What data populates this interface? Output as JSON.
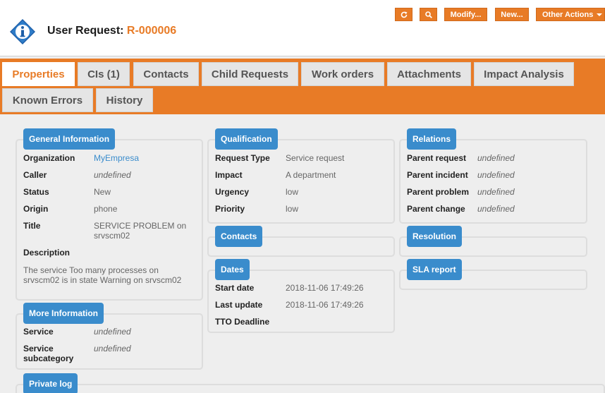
{
  "header": {
    "title_prefix": "User Request: ",
    "ref": "R-000006",
    "buttons": {
      "modify": "Modify...",
      "new": "New...",
      "other_actions": "Other Actions"
    }
  },
  "tabs": [
    "Properties",
    "CIs (1)",
    "Contacts",
    "Child Requests",
    "Work orders",
    "Attachments",
    "Impact Analysis",
    "Known Errors",
    "History"
  ],
  "general": {
    "legend": "General Information",
    "organization_label": "Organization",
    "organization_value": "MyEmpresa",
    "caller_label": "Caller",
    "caller_value": "undefined",
    "status_label": "Status",
    "status_value": "New",
    "origin_label": "Origin",
    "origin_value": "phone",
    "title_label": "Title",
    "title_value_1": "SERVICE PROBLEM on",
    "title_value_2": "srvscm02",
    "description_label": "Description",
    "description_1": "The service Too many processes on",
    "description_2": "srvscm02 is in state Warning on srvscm02"
  },
  "more": {
    "legend": "More Information",
    "service_label": "Service",
    "service_value": "undefined",
    "subcat_label_1": "Service",
    "subcat_label_2": "subcategory",
    "subcat_value": "undefined"
  },
  "private_log": {
    "legend": "Private log"
  },
  "qualification": {
    "legend": "Qualification",
    "request_type_label": "Request Type",
    "request_type_value": "Service request",
    "impact_label": "Impact",
    "impact_value": "A department",
    "urgency_label": "Urgency",
    "urgency_value": "low",
    "priority_label": "Priority",
    "priority_value": "low"
  },
  "contacts": {
    "legend": "Contacts"
  },
  "dates": {
    "legend": "Dates",
    "start_label": "Start date",
    "start_value": "2018-11-06 17:49:26",
    "update_label": "Last update",
    "update_value": "2018-11-06 17:49:26",
    "tto_label": "TTO Deadline"
  },
  "relations": {
    "legend": "Relations",
    "parent_request_label": "Parent request",
    "parent_request_value": "undefined",
    "parent_incident_label": "Parent incident",
    "parent_incident_value": "undefined",
    "parent_problem_label": "Parent problem",
    "parent_problem_value": "undefined",
    "parent_change_label": "Parent change",
    "parent_change_value": "undefined"
  },
  "resolution": {
    "legend": "Resolution"
  },
  "sla": {
    "legend": "SLA report"
  },
  "colors": {
    "accent": "#e87b26",
    "legend_blue": "#3a8ccc"
  },
  "icons": [
    "info-logo-icon",
    "refresh-icon",
    "search-icon",
    "caret-down-icon"
  ]
}
